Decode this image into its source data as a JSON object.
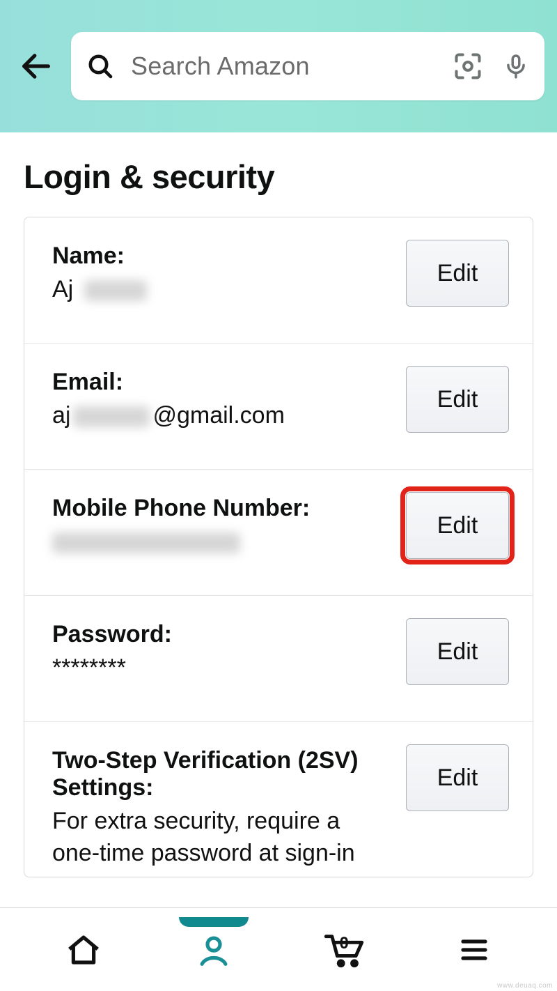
{
  "header": {
    "search_placeholder": "Search Amazon"
  },
  "page": {
    "title": "Login & security"
  },
  "settings": {
    "name": {
      "label": "Name:",
      "value_visible": "Aj",
      "edit_label": "Edit"
    },
    "email": {
      "label": "Email:",
      "value_prefix": "aj",
      "value_suffix": "@gmail.com",
      "edit_label": "Edit"
    },
    "phone": {
      "label": "Mobile Phone Number:",
      "edit_label": "Edit"
    },
    "password": {
      "label": "Password:",
      "value": "********",
      "edit_label": "Edit"
    },
    "twosv": {
      "label": "Two-Step Verification (2SV) Settings:",
      "value": "For extra security, require a one-time password at sign-in",
      "edit_label": "Edit"
    }
  },
  "nav": {
    "cart_count": "0"
  },
  "watermark": "www.deuaq.com"
}
